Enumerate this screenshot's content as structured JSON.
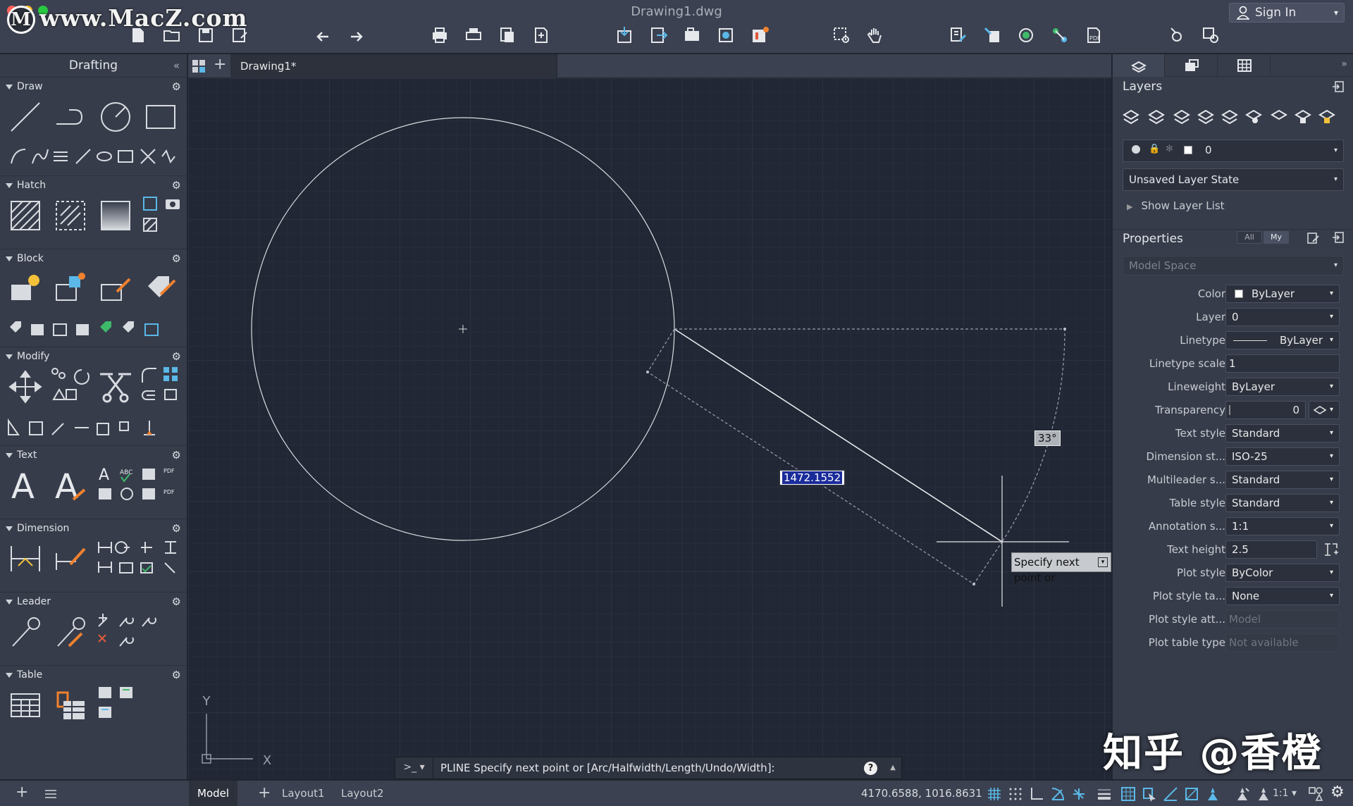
{
  "window": {
    "title": "Drawing1.dwg",
    "watermark": "www.MacZ.com",
    "watermark_logo": "M",
    "sign_in": "Sign In",
    "traffic_colors": [
      "#ff5f57",
      "#febc2e",
      "#28c840"
    ]
  },
  "left_palette": {
    "title": "Drafting",
    "collapse": "«",
    "sections": {
      "draw": "Draw",
      "hatch": "Hatch",
      "block": "Block",
      "modify": "Modify",
      "text": "Text",
      "dimension": "Dimension",
      "leader": "Leader",
      "table": "Table"
    }
  },
  "tabs": {
    "drawing": "Drawing1*",
    "new_tab": "+"
  },
  "canvas": {
    "dynamic_length": "1472.1552",
    "angle": "33°",
    "tooltip": "Specify next point or",
    "tooltip_dropdown": "▾",
    "ucs_x": "X",
    "ucs_y": "Y"
  },
  "command_line": {
    "prompt_glyph": ">_ ▾",
    "text": "PLINE Specify next point or [Arc/Halfwidth/Length/Undo/Width]:",
    "help": "?",
    "expand": "▲"
  },
  "right_palette": {
    "collapse": "»",
    "layers": {
      "title": "Layers",
      "current_layer": "0",
      "layer_state": "Unsaved Layer State",
      "show_layer_list": "Show Layer List"
    },
    "properties": {
      "title": "Properties",
      "filter_all": "All",
      "filter_my": "My",
      "space": "Model Space",
      "rows": [
        {
          "label": "Color",
          "value": "ByLayer"
        },
        {
          "label": "Layer",
          "value": "0"
        },
        {
          "label": "Linetype",
          "value": "ByLayer"
        },
        {
          "label": "Linetype scale",
          "value": "1"
        },
        {
          "label": "Lineweight",
          "value": "ByLayer"
        },
        {
          "label": "Transparency",
          "value": "0"
        },
        {
          "label": "Text style",
          "value": "Standard"
        },
        {
          "label": "Dimension st...",
          "value": "ISO-25"
        },
        {
          "label": "Multileader s...",
          "value": "Standard"
        },
        {
          "label": "Table style",
          "value": "Standard"
        },
        {
          "label": "Annotation s...",
          "value": "1:1"
        },
        {
          "label": "Text height",
          "value": "2.5"
        },
        {
          "label": "Plot style",
          "value": "ByColor"
        },
        {
          "label": "Plot style ta...",
          "value": "None"
        },
        {
          "label": "Plot style att...",
          "value": "Model"
        },
        {
          "label": "Plot table type",
          "value": "Not available"
        }
      ]
    }
  },
  "status_bar": {
    "model": "Model",
    "add_layout": "+",
    "layout1": "Layout1",
    "layout2": "Layout2",
    "coordinates": "4170.6588, 1016.8631",
    "scale": "1:1 ▾"
  },
  "overlay_watermark": "知乎 @香橙"
}
